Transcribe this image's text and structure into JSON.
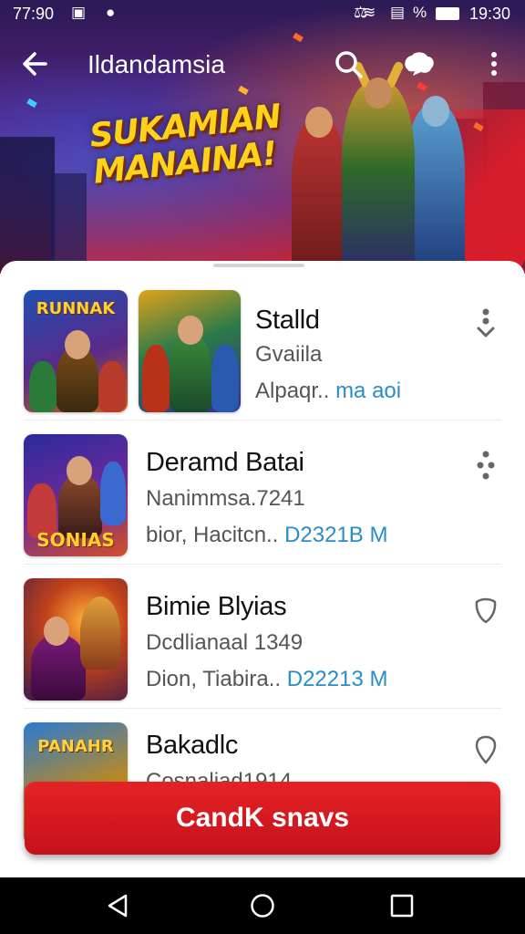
{
  "status_bar": {
    "time_left": "77:90",
    "battery_text": "%",
    "time_right": "19:30"
  },
  "app_bar": {
    "title": "Ildandamsia",
    "icons": [
      "arrow-left-icon",
      "search-icon",
      "chat-bubble-icon",
      "more-vertical-icon"
    ]
  },
  "hero": {
    "headline_line1": "SUKAMIAN",
    "headline_line2": "MANAINA!",
    "colors": {
      "title": "#ffd21a",
      "accent": "#c3283c"
    }
  },
  "list": {
    "items": [
      {
        "name": "Stalld",
        "subtitle": "Gvaiila",
        "meta_prefix": "Alpaqr..",
        "meta_value": "ma aoi",
        "thumb_text": "RUNNAK",
        "second_thumb": true,
        "action_icon": "download-icon"
      },
      {
        "name": "Deramd Batai",
        "subtitle": "Nanimmsa.7241",
        "meta_prefix": "bior,   Hacitcn..",
        "meta_value": "D2321B M",
        "thumb_text": "SONIAS",
        "second_thumb": false,
        "action_icon": "more-dots-icon"
      },
      {
        "name": "Bimie Blyias",
        "subtitle": "Dcdlianaal 1349",
        "meta_prefix": "Dion,   Tiabira..",
        "meta_value": "D22213 M",
        "thumb_text": "",
        "second_thumb": false,
        "action_icon": "shield-icon"
      },
      {
        "name": "Bakadlc",
        "subtitle": "Cosnaliad1914",
        "meta_prefix": "",
        "meta_value": "",
        "thumb_text": "PANAHR",
        "second_thumb": false,
        "action_icon": "map-pin-icon"
      }
    ]
  },
  "cta": {
    "label": "CandK snavs",
    "color": "#d31a20"
  },
  "nav_bar": {
    "icons": [
      "nav-back-icon",
      "nav-home-icon",
      "nav-recents-icon"
    ]
  }
}
